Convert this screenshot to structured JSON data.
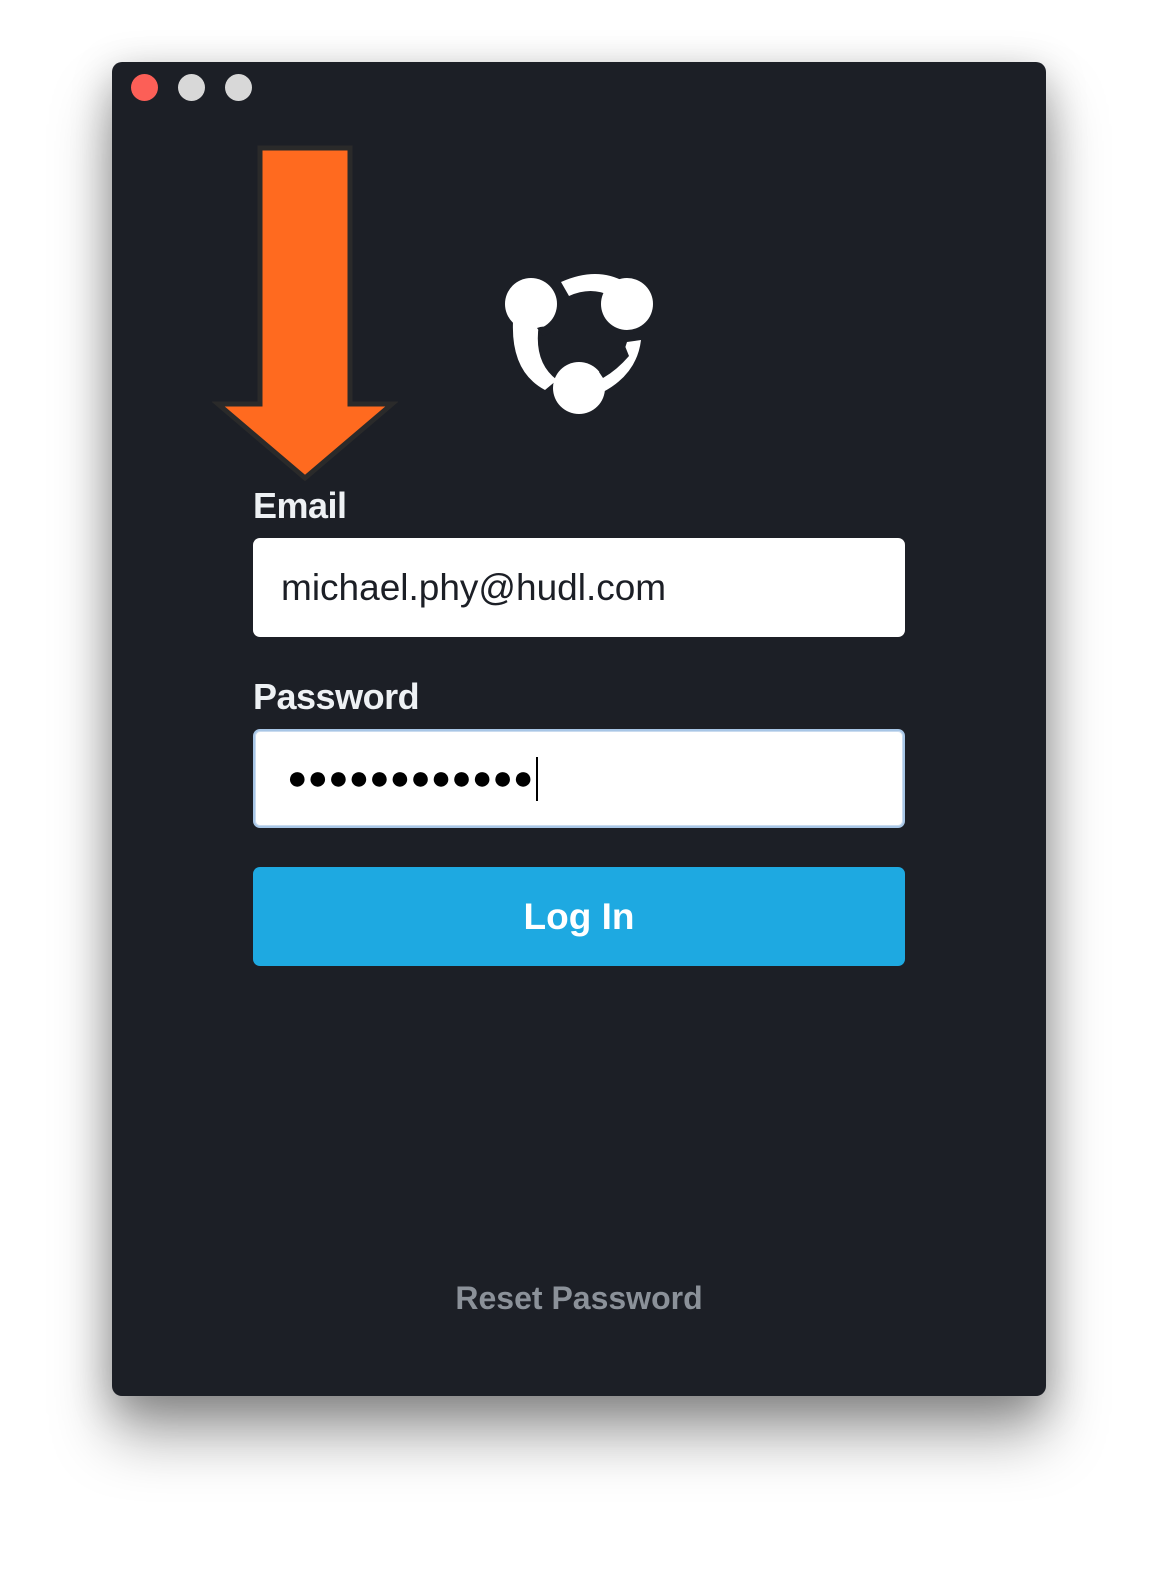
{
  "window": {
    "controls": [
      "close",
      "minimize",
      "maximize"
    ]
  },
  "logo": {
    "icon": "hudl-logo-icon"
  },
  "annotation": {
    "icon": "arrow-down-icon",
    "color": "#ff6a1f"
  },
  "form": {
    "email_label": "Email",
    "email_value": "michael.phy@hudl.com",
    "password_label": "Password",
    "password_value": "●●●●●●●●●●●●",
    "login_label": "Log In",
    "reset_label": "Reset Password"
  },
  "colors": {
    "background": "#1c1f26",
    "accent": "#1ea9e1",
    "close": "#fc5f57"
  }
}
